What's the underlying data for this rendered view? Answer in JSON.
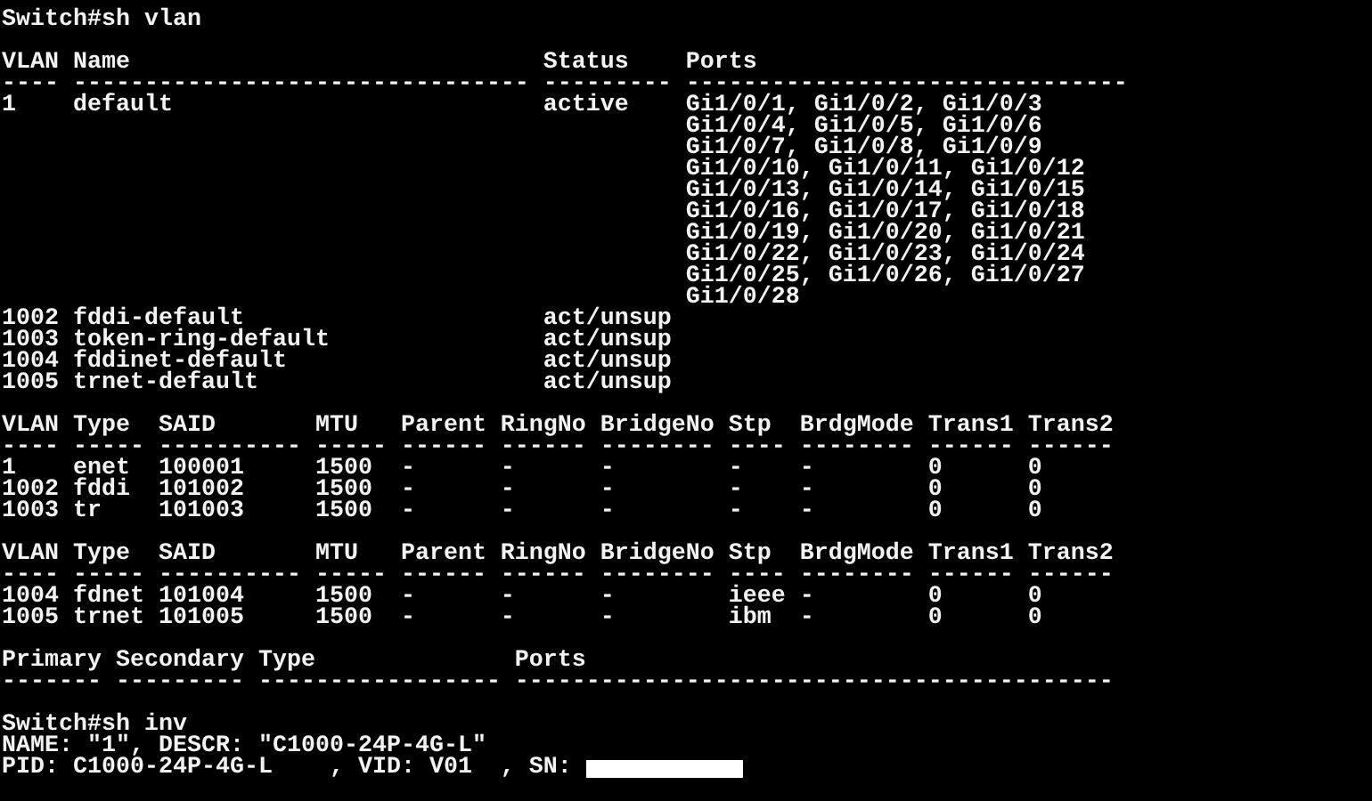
{
  "terminal": {
    "lines": [
      {
        "kind": "text",
        "text": "Switch#sh vlan"
      },
      {
        "kind": "blank"
      },
      {
        "kind": "text",
        "text": "VLAN Name                             Status    Ports"
      },
      {
        "kind": "text",
        "text": "---- -------------------------------- --------- -------------------------------"
      },
      {
        "kind": "text",
        "text": "1    default                          active    Gi1/0/1, Gi1/0/2, Gi1/0/3"
      },
      {
        "kind": "text",
        "text": "                                                Gi1/0/4, Gi1/0/5, Gi1/0/6"
      },
      {
        "kind": "text",
        "text": "                                                Gi1/0/7, Gi1/0/8, Gi1/0/9"
      },
      {
        "kind": "text",
        "text": "                                                Gi1/0/10, Gi1/0/11, Gi1/0/12"
      },
      {
        "kind": "text",
        "text": "                                                Gi1/0/13, Gi1/0/14, Gi1/0/15"
      },
      {
        "kind": "text",
        "text": "                                                Gi1/0/16, Gi1/0/17, Gi1/0/18"
      },
      {
        "kind": "text",
        "text": "                                                Gi1/0/19, Gi1/0/20, Gi1/0/21"
      },
      {
        "kind": "text",
        "text": "                                                Gi1/0/22, Gi1/0/23, Gi1/0/24"
      },
      {
        "kind": "text",
        "text": "                                                Gi1/0/25, Gi1/0/26, Gi1/0/27"
      },
      {
        "kind": "text",
        "text": "                                                Gi1/0/28"
      },
      {
        "kind": "text",
        "text": "1002 fddi-default                     act/unsup"
      },
      {
        "kind": "text",
        "text": "1003 token-ring-default               act/unsup"
      },
      {
        "kind": "text",
        "text": "1004 fddinet-default                  act/unsup"
      },
      {
        "kind": "text",
        "text": "1005 trnet-default                    act/unsup"
      },
      {
        "kind": "blank"
      },
      {
        "kind": "text",
        "text": "VLAN Type  SAID       MTU   Parent RingNo BridgeNo Stp  BrdgMode Trans1 Trans2"
      },
      {
        "kind": "text",
        "text": "---- ----- ---------- ----- ------ ------ -------- ---- -------- ------ ------"
      },
      {
        "kind": "text",
        "text": "1    enet  100001     1500  -      -      -        -    -        0      0"
      },
      {
        "kind": "text",
        "text": "1002 fddi  101002     1500  -      -      -        -    -        0      0"
      },
      {
        "kind": "text",
        "text": "1003 tr    101003     1500  -      -      -        -    -        0      0"
      },
      {
        "kind": "blank"
      },
      {
        "kind": "text",
        "text": "VLAN Type  SAID       MTU   Parent RingNo BridgeNo Stp  BrdgMode Trans1 Trans2"
      },
      {
        "kind": "text",
        "text": "---- ----- ---------- ----- ------ ------ -------- ---- -------- ------ ------"
      },
      {
        "kind": "text",
        "text": "1004 fdnet 101004     1500  -      -      -        ieee -        0      0"
      },
      {
        "kind": "text",
        "text": "1005 trnet 101005     1500  -      -      -        ibm  -        0      0"
      },
      {
        "kind": "blank"
      },
      {
        "kind": "text",
        "text": "Primary Secondary Type              Ports"
      },
      {
        "kind": "text",
        "text": "------- --------- ----------------- ------------------------------------------"
      },
      {
        "kind": "blank"
      },
      {
        "kind": "text",
        "text": "Switch#sh inv"
      },
      {
        "kind": "text",
        "text": "NAME: \"1\", DESCR: \"C1000-24P-4G-L\""
      },
      {
        "kind": "redacted",
        "text": "PID: C1000-24P-4G-L    , VID: V01  , SN: "
      }
    ]
  }
}
